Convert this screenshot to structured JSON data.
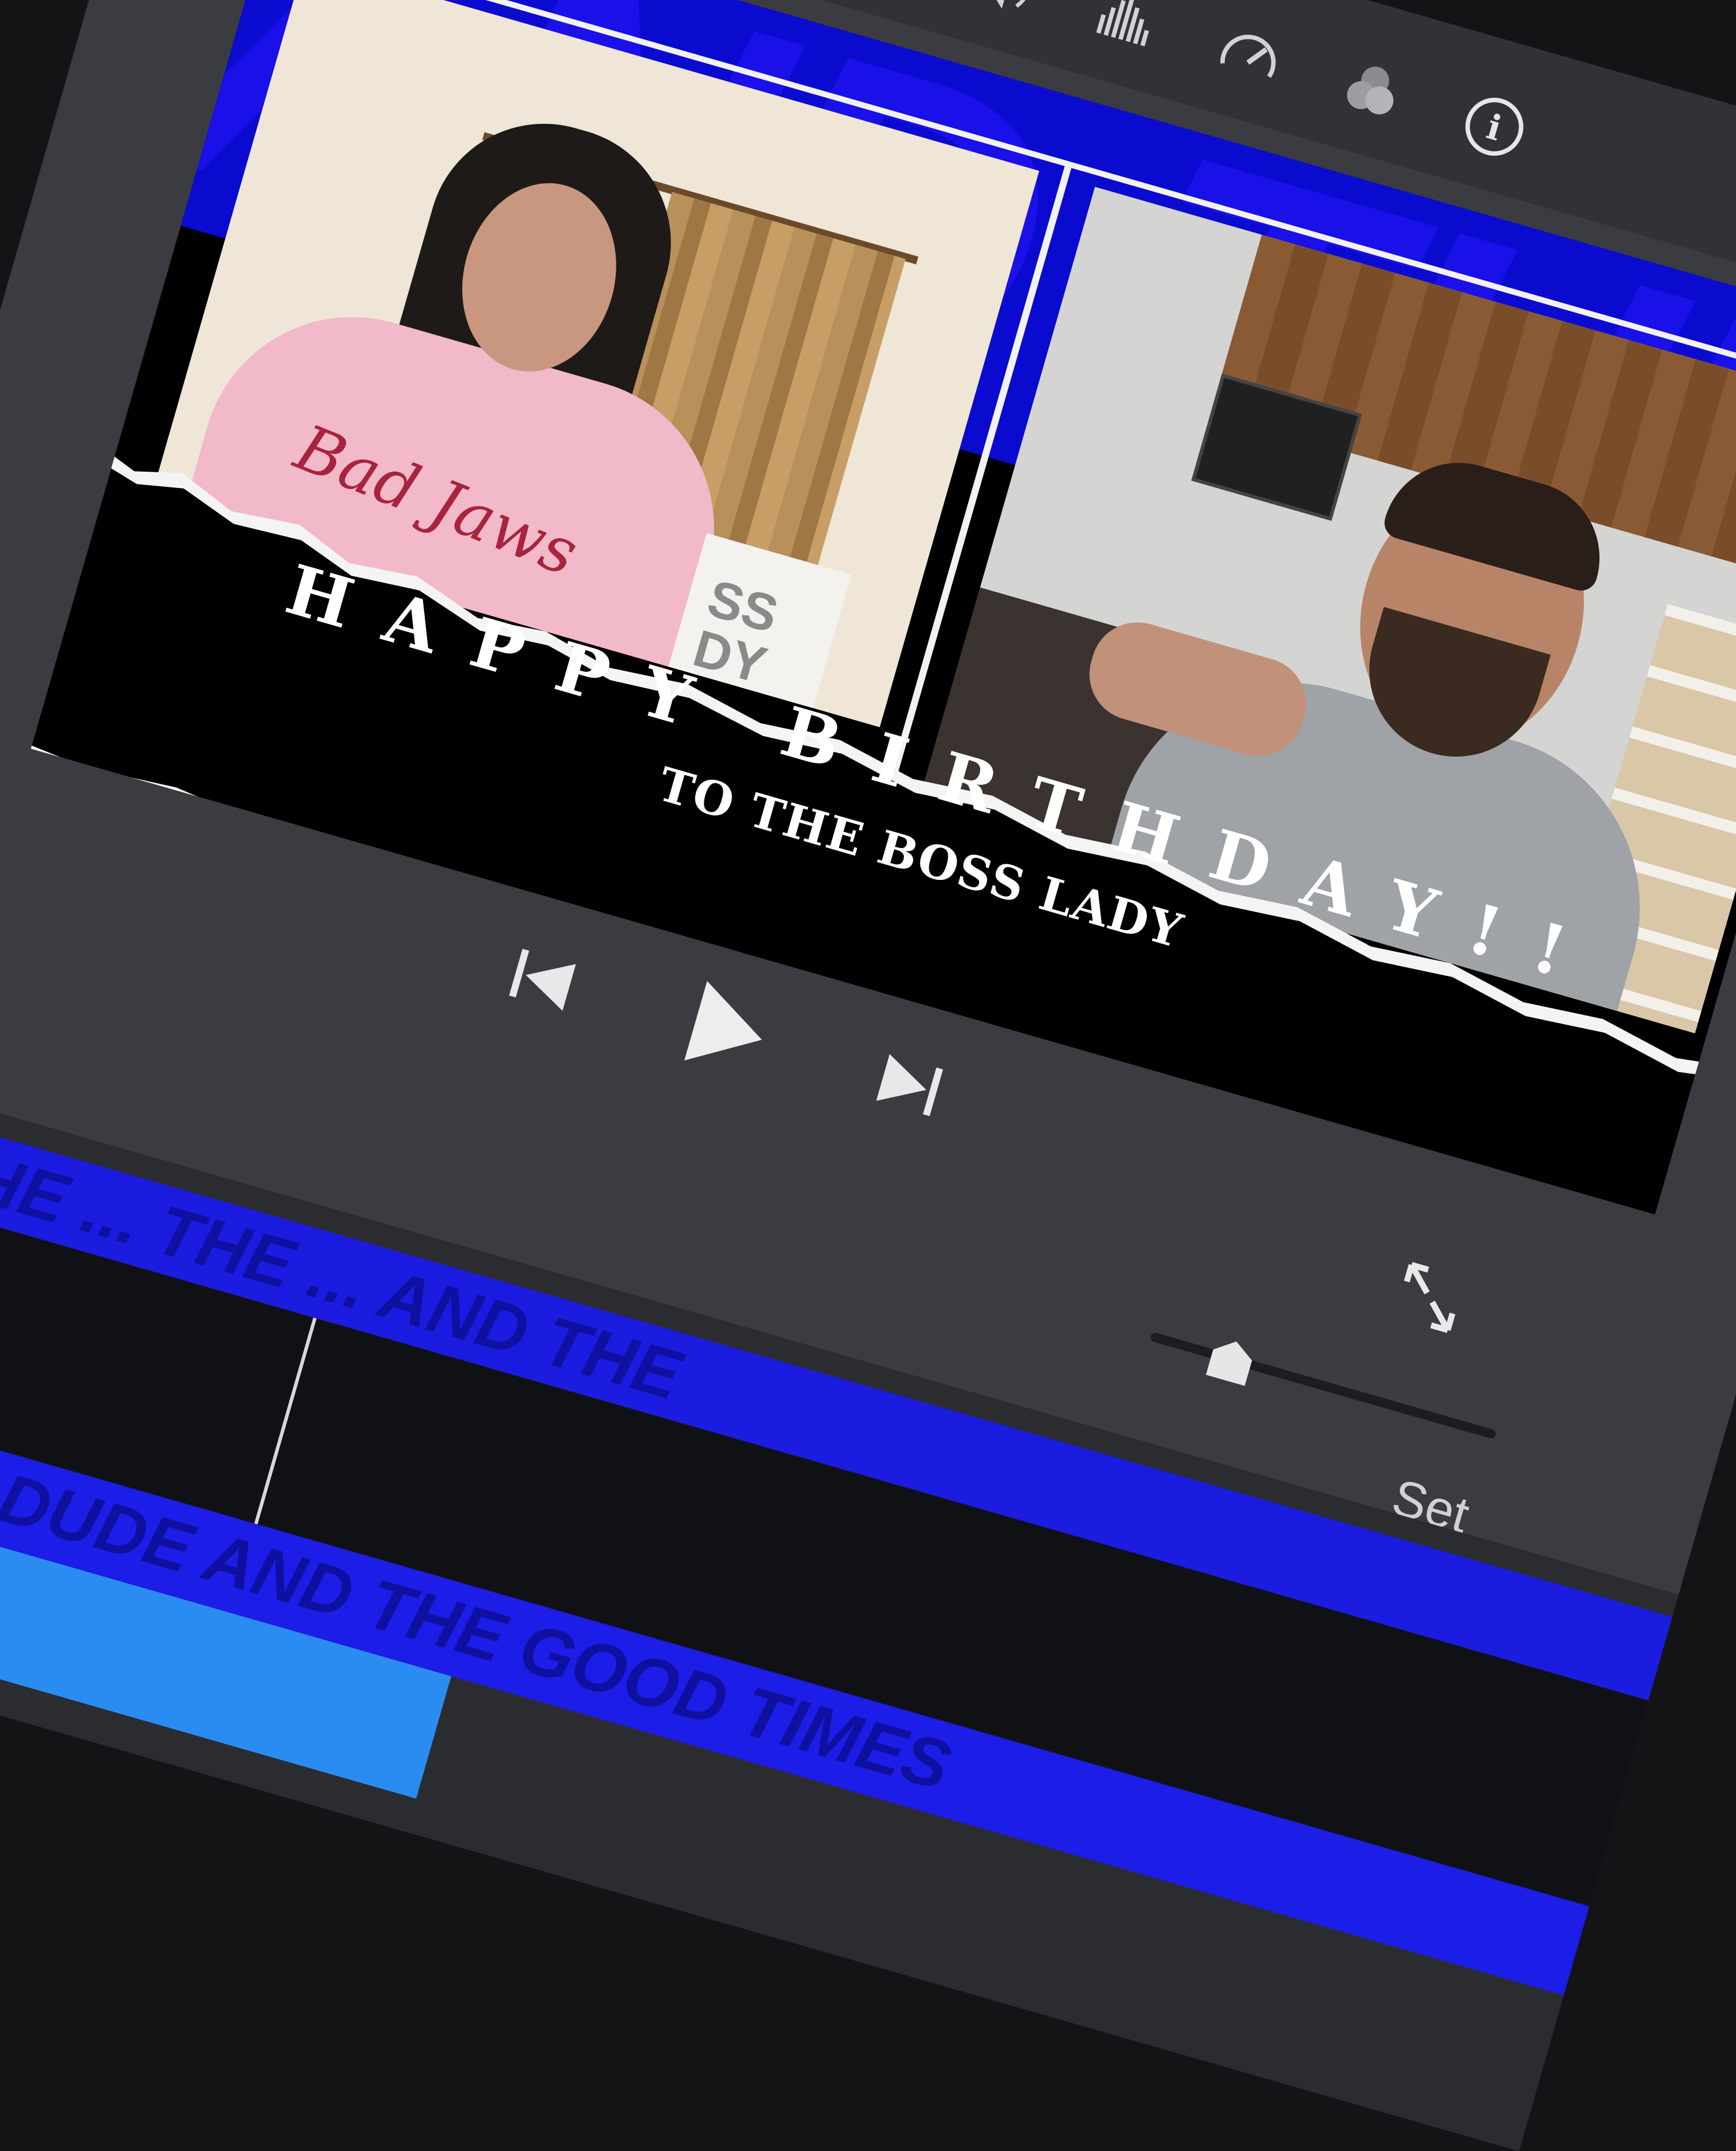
{
  "toolbar": {
    "tools": [
      {
        "name": "crop-icon"
      },
      {
        "name": "stabilization-icon"
      },
      {
        "name": "volume-icon"
      },
      {
        "name": "noise-reduction-icon"
      },
      {
        "name": "speed-icon"
      },
      {
        "name": "color-filter-icon"
      },
      {
        "name": "info-icon"
      }
    ]
  },
  "viewer": {
    "background_text": "AND THE",
    "left_video": {
      "shirt_text": "Bad Jaws",
      "box_text_line1": "SS",
      "box_text_line2": "DY"
    },
    "title_main": "HAPPY BIRTHDAY!!",
    "title_sub": "TO THE BOSS LADY"
  },
  "playback": {
    "skip_back": "skip-back-icon",
    "play": "play-icon",
    "skip_forward": "skip-forward-icon"
  },
  "zoom": {
    "level": 0.2
  },
  "settings_label": "Set",
  "timeline": {
    "track1_text": "AND THE ... THE ... AND THE",
    "track2_text": "AND THE DUDE AND THE GOOD TIMES"
  },
  "colors": {
    "accent_blue": "#0d10d8",
    "panel_dark": "#3a3c41",
    "banner_black": "#000000"
  }
}
